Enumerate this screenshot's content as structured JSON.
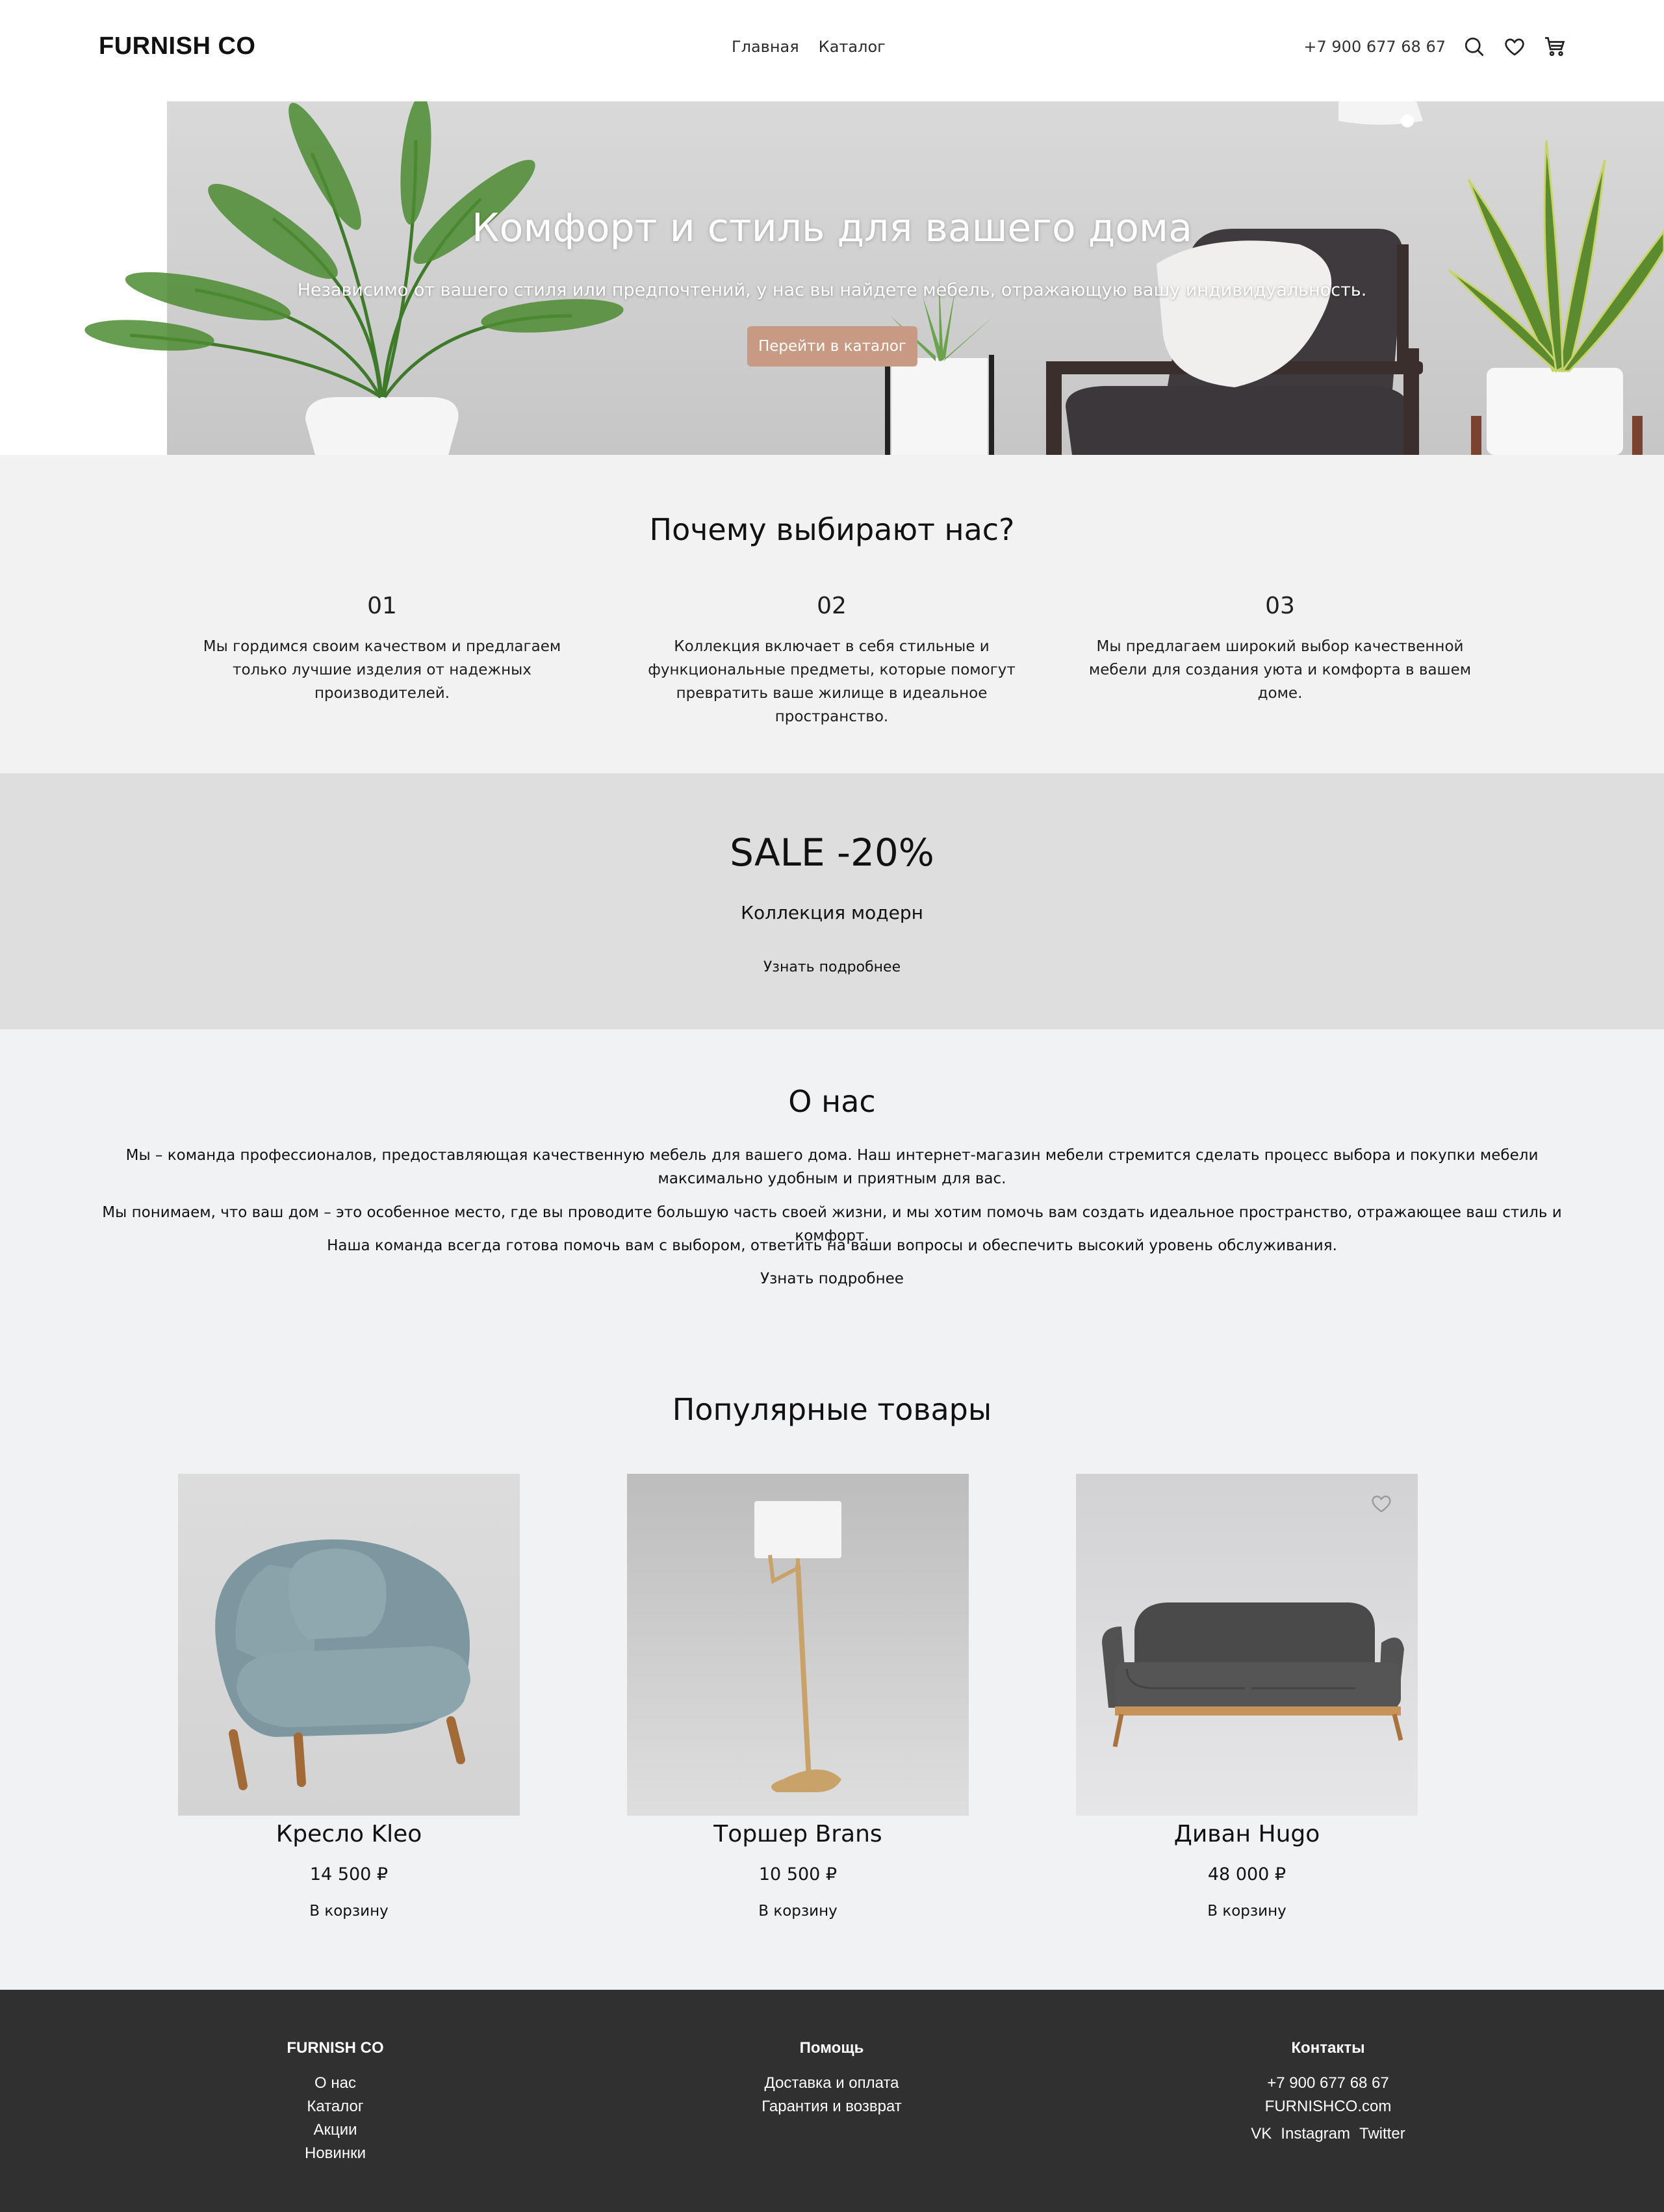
{
  "header": {
    "logo": "FURNISH CO",
    "nav": [
      "Главная",
      "Каталог"
    ],
    "phone": "+7 900 677 68 67",
    "icons": [
      "search-icon",
      "heart-icon",
      "cart-icon"
    ]
  },
  "hero": {
    "title": "Комфорт и стиль для вашего дома",
    "subtitle": "Независимо от вашего стиля или предпочтений, у нас вы найдете мебель, отражающую вашу индивидуальность.",
    "button": "Перейти в каталог",
    "button_color": "#c99a83"
  },
  "why": {
    "title": "Почему выбирают нас?",
    "features": [
      {
        "num": "01",
        "text": "Мы гордимся своим качеством и предлагаем только лучшие изделия от надежных производителей."
      },
      {
        "num": "02",
        "text": "Коллекция включает в себя стильные и функциональные предметы, которые помогут превратить ваше жилище в идеальное пространство."
      },
      {
        "num": "03",
        "text": "Мы предлагаем широкий выбор качественной мебели для создания уюта и комфорта в вашем доме."
      }
    ]
  },
  "sale": {
    "title": "SALE -20%",
    "subtitle": "Коллекция модерн",
    "link": "Узнать подробнее"
  },
  "about": {
    "title": "О нас",
    "paragraphs": [
      "Мы – команда профессионалов, предоставляющая качественную мебель для вашего дома. Наш интернет-магазин мебели стремится сделать процесс выбора и покупки мебели максимально удобным и приятным для вас.",
      "Мы понимаем, что ваш дом – это особенное место, где вы проводите большую часть своей жизни, и мы хотим помочь вам создать идеальное пространство, отражающее ваш стиль и комфорт.",
      "Наша команда всегда готова помочь вам с выбором, ответить на ваши вопросы и обеспечить высокий уровень обслуживания."
    ],
    "link": "Узнать подробнее"
  },
  "popular": {
    "title": "Популярные товары",
    "products": [
      {
        "name": "Кресло Kleo",
        "price": "14 500 ₽",
        "cart": "В корзину"
      },
      {
        "name": "Торшер Brans",
        "price": "10 500 ₽",
        "cart": "В корзину"
      },
      {
        "name": "Диван Hugo",
        "price": "48 000 ₽",
        "cart": "В корзину"
      }
    ]
  },
  "footer": {
    "brand": {
      "title": "FURNISH CO",
      "links": [
        "О нас",
        "Каталог",
        "Акции",
        "Новинки"
      ]
    },
    "help": {
      "title": "Помощь",
      "links": [
        "Доставка и оплата",
        "Гарантия и возврат"
      ]
    },
    "contacts": {
      "title": "Контакты",
      "phone": "+7 900 677 68 67",
      "site": "FURNISHCO.com",
      "social": [
        "VK",
        "Instagram",
        "Twitter"
      ]
    }
  }
}
